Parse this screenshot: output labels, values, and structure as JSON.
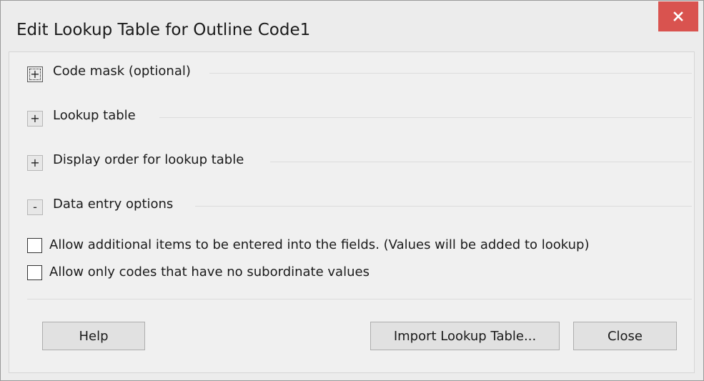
{
  "window": {
    "title": "Edit Lookup Table for Outline Code1",
    "close_glyph": "✕"
  },
  "sections": [
    {
      "toggle": "+",
      "label": "Code mask (optional)"
    },
    {
      "toggle": "+",
      "label": "Lookup table"
    },
    {
      "toggle": "+",
      "label": "Display order for lookup table"
    },
    {
      "toggle": "-",
      "label": "Data entry options"
    }
  ],
  "options": [
    {
      "label": "Allow additional items to be entered into the fields. (Values will be added to lookup)",
      "checked": false
    },
    {
      "label": "Allow only codes that have no subordinate values",
      "checked": false
    }
  ],
  "buttons": {
    "help": "Help",
    "import": "Import Lookup Table...",
    "close": "Close"
  },
  "colors": {
    "close_button_bg": "#d9534f",
    "dialog_bg": "#f0f0f0"
  }
}
